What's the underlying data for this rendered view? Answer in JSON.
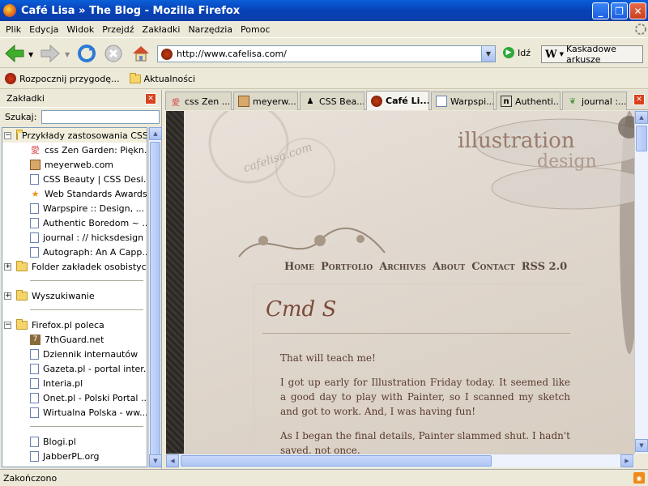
{
  "window": {
    "title": "Café Lisa » The Blog - Mozilla Firefox",
    "min": "_",
    "max": "❐",
    "close": "✕"
  },
  "menu": [
    "Plik",
    "Edycja",
    "Widok",
    "Przejdź",
    "Zakładki",
    "Narzędzia",
    "Pomoc"
  ],
  "nav": {
    "url": "http://www.cafelisa.com/",
    "go_label": "Idź",
    "css_button": "Kaskadowe arkusze"
  },
  "bookmarks_toolbar": [
    {
      "label": "Rozpocznij przygodę...",
      "icon": "firefox-icon"
    },
    {
      "label": "Aktualności",
      "icon": "folder-icon"
    }
  ],
  "sidebar": {
    "title": "Zakładki",
    "search_label": "Szukaj:",
    "tree": [
      {
        "label": "Przykłady zastosowania CSS",
        "type": "folder",
        "expanded": true,
        "depth": 0
      },
      {
        "label": "css Zen Garden: Piękn...",
        "type": "page",
        "icon": "zen-icon",
        "depth": 1
      },
      {
        "label": "meyerweb.com",
        "type": "page",
        "icon": "meyer-icon",
        "depth": 1
      },
      {
        "label": "CSS Beauty | CSS Desi...",
        "type": "page",
        "depth": 1
      },
      {
        "label": "Web Standards Awards",
        "type": "page",
        "icon": "star-icon",
        "depth": 1
      },
      {
        "label": "Warpspire :: Design, ...",
        "type": "page",
        "depth": 1
      },
      {
        "label": "Authentic Boredom ~ ...",
        "type": "page",
        "depth": 1
      },
      {
        "label": "journal : // hicksdesign",
        "type": "page",
        "depth": 1
      },
      {
        "label": "Autograph: An A Capp...",
        "type": "page",
        "depth": 1
      },
      {
        "label": "Folder zakładek osobistych",
        "type": "folder",
        "expanded": false,
        "depth": 0
      },
      {
        "label": "Wyszukiwanie",
        "type": "folder",
        "expanded": false,
        "depth": 0
      },
      {
        "label": "Firefox.pl poleca",
        "type": "folder",
        "expanded": true,
        "depth": 0
      },
      {
        "label": "7thGuard.net",
        "type": "page",
        "icon": "guard-icon",
        "depth": 1
      },
      {
        "label": "Dziennik internautów",
        "type": "page",
        "depth": 1
      },
      {
        "label": "Gazeta.pl - portal inter...",
        "type": "page",
        "depth": 1
      },
      {
        "label": "Interia.pl",
        "type": "page",
        "depth": 1
      },
      {
        "label": "Onet.pl - Polski Portal ...",
        "type": "page",
        "depth": 1
      },
      {
        "label": "Wirtualna Polska - ww...",
        "type": "page",
        "depth": 1
      },
      {
        "label": "Blogi.pl",
        "type": "page",
        "depth": 1
      },
      {
        "label": "JabberPL.org",
        "type": "page",
        "depth": 1
      }
    ]
  },
  "tabs": [
    {
      "label": "css Zen ...",
      "icon": "zen-icon"
    },
    {
      "label": "meyerw...",
      "icon": "meyer-icon"
    },
    {
      "label": "CSS Bea...",
      "icon": "cssbeauty-icon"
    },
    {
      "label": "Café Li...",
      "icon": "cafe-icon",
      "active": true
    },
    {
      "label": "Warpspi...",
      "icon": "page-icon"
    },
    {
      "label": "Authenti...",
      "icon": "n-icon"
    },
    {
      "label": "journal :...",
      "icon": "leaf-icon"
    }
  ],
  "page": {
    "script_logo": "cafelisa.com",
    "brand_line1": "illustration",
    "brand_line2": "design",
    "nav": [
      "Home",
      "Portfolio",
      "Archives",
      "About",
      "Contact",
      "RSS 2.0"
    ],
    "post_title": "Cmd S",
    "paragraphs": [
      "That will teach me!",
      "I got up early for Illustration Friday today. It seemed like a good day to play with Painter, so I scanned my sketch and got to work. And, I was having fun!",
      "As I began the final details, Painter slammed shut. I hadn't saved, not once."
    ]
  },
  "status": "Zakończono"
}
